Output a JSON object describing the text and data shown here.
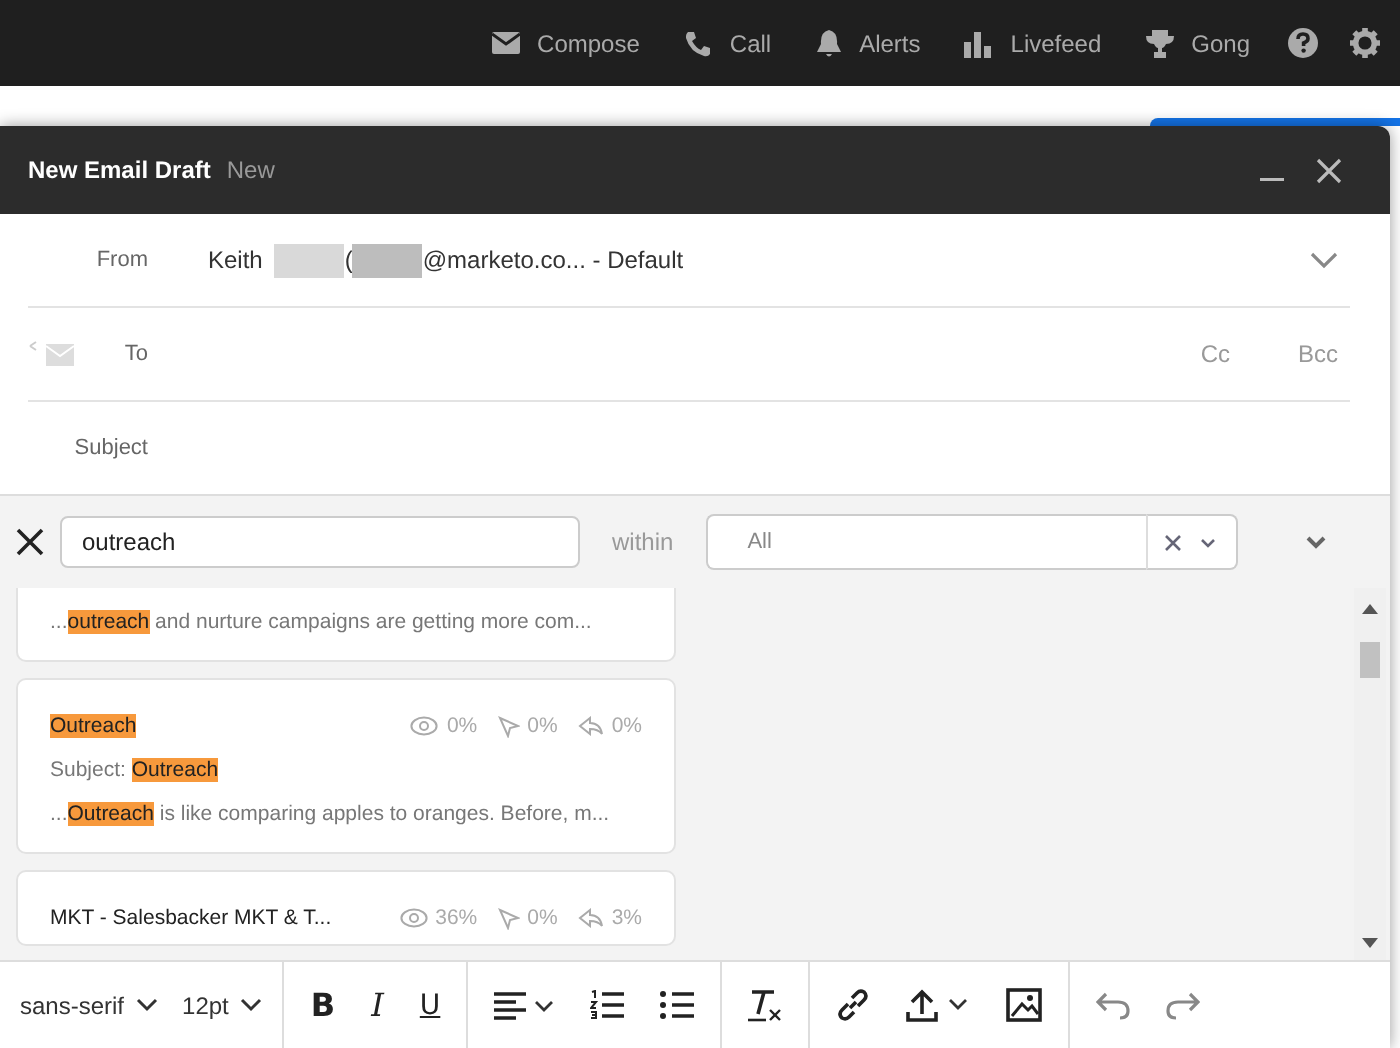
{
  "top_nav": [
    {
      "kind": "mail",
      "label": "Compose"
    },
    {
      "kind": "phone",
      "label": "Call"
    },
    {
      "kind": "bell",
      "label": "Alerts"
    },
    {
      "kind": "bars",
      "label": "Livefeed"
    },
    {
      "kind": "trophy",
      "label": "Gong"
    },
    {
      "kind": "help"
    },
    {
      "kind": "gear"
    }
  ],
  "draft": {
    "title": "New Email Draft",
    "status": "New",
    "from": {
      "label": "From",
      "name": "Keith",
      "open_paren": "(",
      "address": "@marketo.co... - Default"
    },
    "to": {
      "label": "To",
      "cc": "Cc",
      "bcc": "Bcc"
    },
    "subject": {
      "label": "Subject"
    },
    "search": {
      "value": "outreach",
      "within_label": "within",
      "within_value": "All"
    },
    "cards": [
      {
        "snippet": [
          {
            "text": "...",
            "hit": false
          },
          {
            "text": "outreach",
            "hit": true
          },
          {
            "text": " and nurture campaigns are getting more com...",
            "hit": false
          }
        ]
      },
      {
        "title": [
          {
            "text": "Outreach",
            "hit": true
          }
        ],
        "stats": [
          "0%",
          "0%",
          "0%"
        ],
        "subject_label": "Subject:",
        "subject": [
          {
            "text": "Outreach",
            "hit": true
          }
        ],
        "snippet": [
          {
            "text": "...",
            "hit": false
          },
          {
            "text": "Outreach",
            "hit": true
          },
          {
            "text": " is like comparing apples to oranges. Before, m...",
            "hit": false
          }
        ]
      },
      {
        "title": [
          {
            "text": "MKT - Salesbacker MKT & T...",
            "hit": false
          }
        ],
        "stats": [
          "36%",
          "0%",
          "3%"
        ]
      }
    ],
    "toolbar": [
      {
        "kind": "select",
        "label": "sans-serif"
      },
      {
        "kind": "select",
        "label": "12pt"
      },
      {
        "kind": "sep"
      },
      {
        "kind": "bold",
        "label": "B"
      },
      {
        "kind": "italic",
        "label": "I"
      },
      {
        "kind": "underline",
        "label": "U"
      },
      {
        "kind": "sep"
      },
      {
        "kind": "align"
      },
      {
        "kind": "ol"
      },
      {
        "kind": "ul"
      },
      {
        "kind": "sep"
      },
      {
        "kind": "clear"
      },
      {
        "kind": "sep"
      },
      {
        "kind": "link"
      },
      {
        "kind": "upload"
      },
      {
        "kind": "image"
      },
      {
        "kind": "sep"
      },
      {
        "kind": "undo"
      },
      {
        "kind": "redo"
      }
    ]
  }
}
